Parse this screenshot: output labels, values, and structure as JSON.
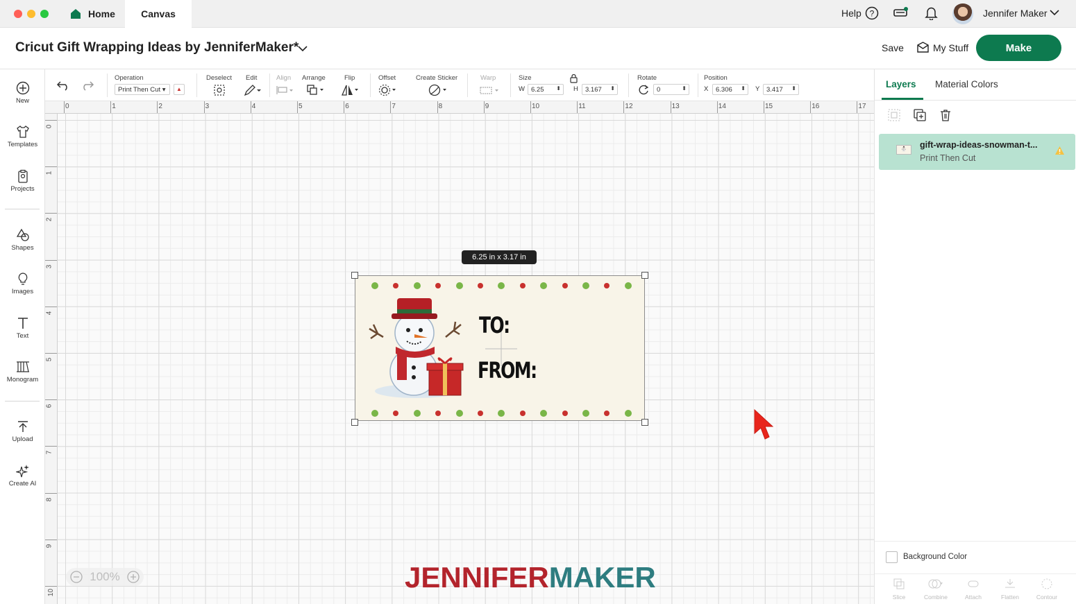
{
  "window": {
    "tabs": [
      {
        "label": "Home",
        "icon": "home-icon"
      },
      {
        "label": "Canvas"
      }
    ],
    "help_label": "Help",
    "user_name": "Jennifer Maker"
  },
  "project": {
    "title": "Cricut Gift Wrapping Ideas by JenniferMaker*",
    "save_label": "Save",
    "mystuff_label": "My Stuff",
    "make_label": "Make"
  },
  "sidebar": {
    "items": [
      {
        "label": "New",
        "icon": "plus-circle-icon"
      },
      {
        "label": "Templates",
        "icon": "shirt-icon"
      },
      {
        "label": "Projects",
        "icon": "clipboard-icon"
      },
      {
        "label": "Shapes",
        "icon": "shapes-icon"
      },
      {
        "label": "Images",
        "icon": "lightbulb-icon"
      },
      {
        "label": "Text",
        "icon": "text-icon"
      },
      {
        "label": "Monogram",
        "icon": "monogram-icon"
      },
      {
        "label": "Upload",
        "icon": "upload-icon"
      },
      {
        "label": "Create AI",
        "icon": "sparkle-icon"
      }
    ]
  },
  "toolbar": {
    "operation_label": "Operation",
    "operation_value": "Print Then Cut",
    "deselect_label": "Deselect",
    "edit_label": "Edit",
    "align_label": "Align",
    "arrange_label": "Arrange",
    "flip_label": "Flip",
    "offset_label": "Offset",
    "create_sticker_label": "Create Sticker",
    "warp_label": "Warp",
    "size_label": "Size",
    "w_label": "W",
    "w_value": "6.25",
    "h_label": "H",
    "h_value": "3.167",
    "rotate_label": "Rotate",
    "rotate_value": "0",
    "position_label": "Position",
    "x_label": "X",
    "x_value": "6.306",
    "y_label": "Y",
    "y_value": "3.417"
  },
  "rulers": {
    "top": [
      "0",
      "1",
      "2",
      "3",
      "4",
      "5",
      "6",
      "7",
      "8",
      "9",
      "10",
      "11",
      "12",
      "13",
      "14",
      "15",
      "16",
      "17"
    ],
    "left": [
      "0",
      "1",
      "2",
      "3",
      "4",
      "5",
      "6",
      "7",
      "8",
      "9",
      "10"
    ]
  },
  "canvas": {
    "dimension_tag": "6.25  in x 3.17  in",
    "tag_to": "TO:",
    "tag_from": "FROM:",
    "zoom": "100%",
    "watermark_part1": "JENNIFER",
    "watermark_part2": "MAKER",
    "colors": {
      "dot_green": "#7ab648",
      "dot_red": "#c8312e",
      "tag_bg": "#f8f4e8",
      "watermark_red": "#b3242c",
      "watermark_teal": "#2e7d80"
    }
  },
  "right_panel": {
    "tabs": [
      {
        "label": "Layers"
      },
      {
        "label": "Material Colors"
      }
    ],
    "layer_name": "gift-wrap-ideas-snowman-t...",
    "layer_op": "Print Then Cut",
    "background_color_label": "Background Color",
    "bottom_actions": [
      "Slice",
      "Combine",
      "Attach",
      "Flatten",
      "Contour"
    ]
  },
  "accent_color": "#0d7a4f"
}
